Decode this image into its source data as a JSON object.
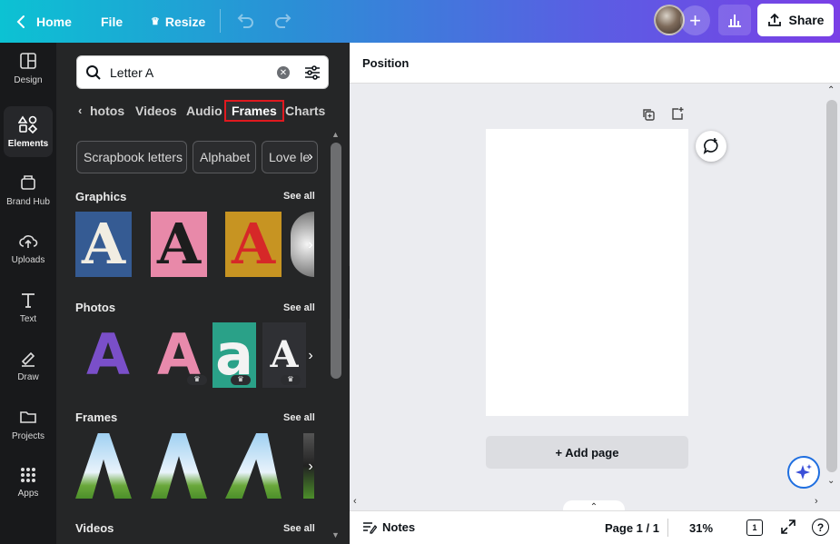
{
  "topbar": {
    "home_label": "Home",
    "file_label": "File",
    "resize_label": "Resize",
    "share_label": "Share"
  },
  "rail": {
    "items": [
      {
        "label": "Design",
        "icon": "layout-icon"
      },
      {
        "label": "Elements",
        "icon": "shapes-icon",
        "active": true
      },
      {
        "label": "Brand Hub",
        "icon": "brand-icon"
      },
      {
        "label": "Uploads",
        "icon": "cloud-upload-icon"
      },
      {
        "label": "Text",
        "icon": "text-icon"
      },
      {
        "label": "Draw",
        "icon": "pen-icon"
      },
      {
        "label": "Projects",
        "icon": "folder-icon"
      },
      {
        "label": "Apps",
        "icon": "apps-grid-icon"
      }
    ]
  },
  "panel": {
    "search": {
      "value": "Letter A"
    },
    "tabs": [
      "hotos",
      "Videos",
      "Audio",
      "Frames",
      "Charts"
    ],
    "active_tab": "Frames",
    "chips": [
      "Scrapbook letters",
      "Alphabet",
      "Love le"
    ],
    "sections": [
      {
        "title": "Graphics",
        "see_all": "See all"
      },
      {
        "title": "Photos",
        "see_all": "See all"
      },
      {
        "title": "Frames",
        "see_all": "See all"
      },
      {
        "title": "Videos",
        "see_all": "See all"
      }
    ],
    "thumb_letters": {
      "graphics": [
        "A",
        "A",
        "A"
      ],
      "photos": [
        "A",
        "A",
        "a",
        "A"
      ],
      "frames": [
        "A",
        "A",
        "A"
      ]
    }
  },
  "editor": {
    "position_label": "Position",
    "add_page_label": "+ Add page"
  },
  "bottombar": {
    "notes_label": "Notes",
    "page_indicator": "Page 1 / 1",
    "zoom": "31%",
    "grid_count": "1",
    "help": "?"
  },
  "colors": {
    "accent_red": "#e0191f",
    "panel_bg": "#252627",
    "rail_bg": "#18191b",
    "magic_blue": "#1f6fe0"
  }
}
